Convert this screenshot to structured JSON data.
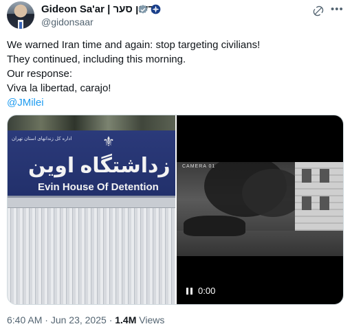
{
  "author": {
    "name": "Gideon Sa'ar | גדעון סער",
    "handle": "@gidonsaar"
  },
  "tweet": {
    "lines": [
      "We warned Iran time and again: stop targeting civilians!",
      "They continued, including this morning.",
      "Our response:",
      "Viva la libertad, carajo!"
    ],
    "mention": "@JMilei"
  },
  "media": {
    "photo_sign_persian": "زداشتگاه اوین",
    "photo_sign_english": "Evin House Of Detention",
    "photo_sign_small": "اداره کل زندانهای استان تهران",
    "video_overlay_text": "CAMERA 01",
    "video_time": "0:00"
  },
  "meta": {
    "time": "6:40 AM",
    "separator": "·",
    "date": "Jun 23, 2025",
    "views_count": "1.4M",
    "views_label": "Views"
  },
  "icons": [
    "verified-badge-icon",
    "government-badge-icon",
    "grok-icon",
    "more-icon",
    "pause-icon"
  ],
  "colors": {
    "accent": "#1d9bf0",
    "muted": "#536471",
    "text": "#0f1419"
  }
}
